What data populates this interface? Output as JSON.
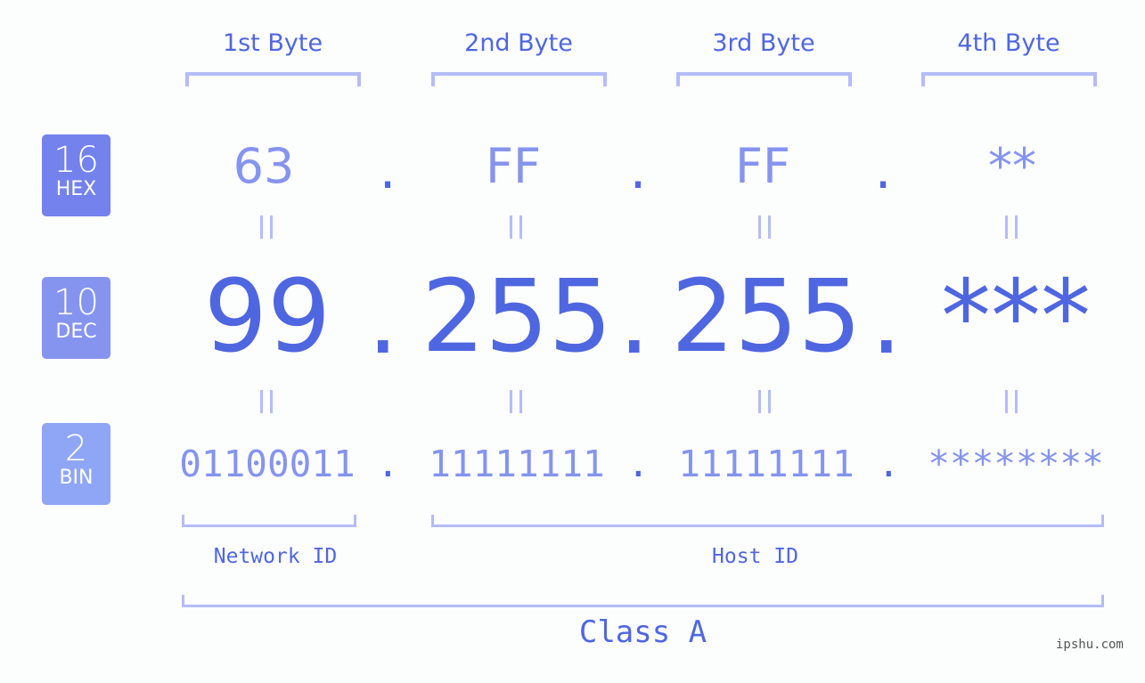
{
  "bytes": {
    "headers": [
      "1st Byte",
      "2nd Byte",
      "3rd Byte",
      "4th Byte"
    ],
    "hex": [
      "63",
      "FF",
      "FF",
      "**"
    ],
    "dec": [
      "99",
      "255",
      "255",
      "***"
    ],
    "bin": [
      "01100011",
      "11111111",
      "11111111",
      "********"
    ],
    "separator": ".",
    "equals": "="
  },
  "badges": [
    {
      "number": "16",
      "label": "HEX",
      "color": "#7382ec"
    },
    {
      "number": "10",
      "label": "DEC",
      "color": "#8594ee"
    },
    {
      "number": "2",
      "label": "BIN",
      "color": "#8fa6f6"
    }
  ],
  "labels": {
    "network_id": "Network ID",
    "host_id": "Host ID",
    "class": "Class A"
  },
  "watermark": "ipshu.com",
  "colors": {
    "primary": "#4f66e1",
    "secondary": "#8594ee",
    "bracket": "#b4bcf8",
    "background": "#fcfdfd"
  }
}
